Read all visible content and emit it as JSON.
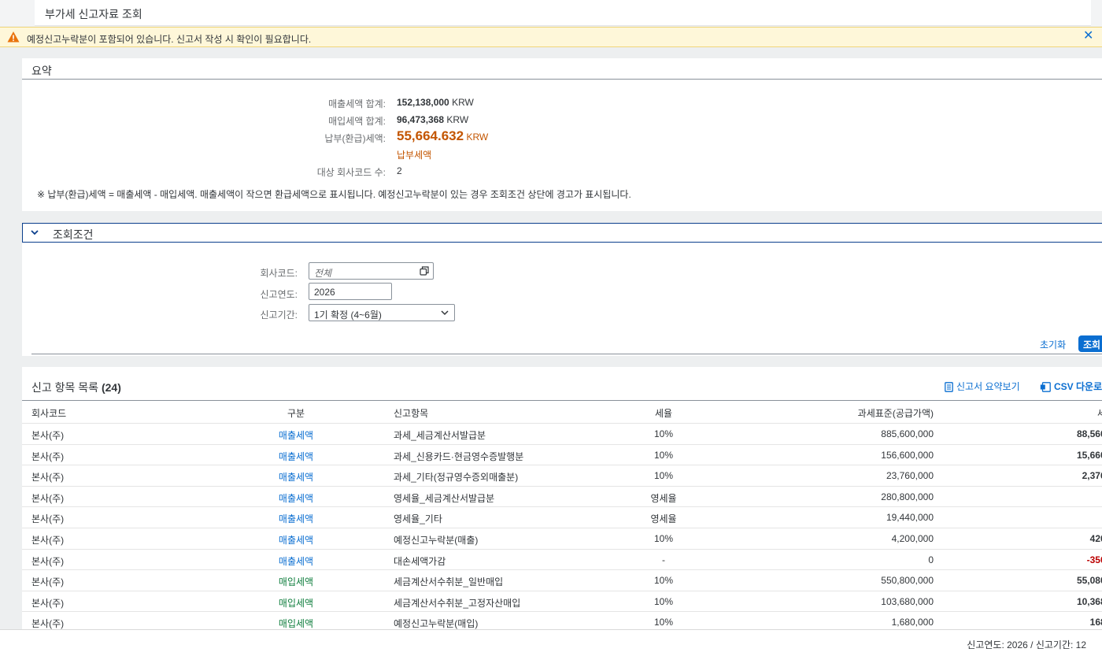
{
  "page": {
    "title": "부가세 신고자료 조회"
  },
  "warning": {
    "text": "예정신고누락분이 포함되어 있습니다. 신고서 작성 시 확인이 필요합니다.",
    "close_icon": "close-icon",
    "colors": {
      "background": "#fef7d9",
      "icon": "#e9730c"
    }
  },
  "summary": {
    "title": "요약",
    "rows": [
      {
        "label": "매출세액 합계:",
        "value": "152,138,000",
        "unit": "KRW"
      },
      {
        "label": "매입세액 합계:",
        "value": "96,473,368",
        "unit": "KRW"
      },
      {
        "label": "납부(환급)세액:",
        "value": "55,664.632",
        "unit": "KRW",
        "sublabel": "납부세액"
      },
      {
        "label": "대상 회사코드 수:",
        "value": "2"
      }
    ],
    "note": "※ 납부(환급)세액 = 매출세액 - 매입세액. 매출세액이 작으면 환급세액으로 표시됩니다. 예정신고누락분이 있는 경우 조회조건 상단에 경고가 표시됩니다.",
    "colors": {
      "payable": "#c35500"
    }
  },
  "conditions": {
    "title": "조회조건",
    "fields": {
      "company": {
        "label": "회사코드:",
        "placeholder": "전체"
      },
      "year": {
        "label": "신고연도:",
        "value": "2026"
      },
      "period": {
        "label": "신고기간:",
        "value": "1기 확정 (4~6월)"
      }
    },
    "reset_label": "초기화",
    "search_label": "조회"
  },
  "table": {
    "title": "신고 항목 목록",
    "count": "(24)",
    "summary_button": "신고서 요약보기",
    "csv_button": "CSV 다운로",
    "columns": [
      "회사코드",
      "구분",
      "신고항목",
      "세율",
      "과세표준(공급가액)",
      "세"
    ],
    "rows": [
      {
        "company": "본사(주)",
        "type": "매출세액",
        "kind": "sales",
        "item": "과세_세금계산서발급분",
        "rate": "10%",
        "base": "885,600,000",
        "tax": "88,560,"
      },
      {
        "company": "본사(주)",
        "type": "매출세액",
        "kind": "sales",
        "item": "과세_신용카드·현금영수증발행분",
        "rate": "10%",
        "base": "156,600,000",
        "tax": "15,660,"
      },
      {
        "company": "본사(주)",
        "type": "매출세액",
        "kind": "sales",
        "item": "과세_기타(정규영수증외매출분)",
        "rate": "10%",
        "base": "23,760,000",
        "tax": "2,376,"
      },
      {
        "company": "본사(주)",
        "type": "매출세액",
        "kind": "sales",
        "item": "영세율_세금계산서발급분",
        "rate": "영세율",
        "base": "280,800,000",
        "tax": ""
      },
      {
        "company": "본사(주)",
        "type": "매출세액",
        "kind": "sales",
        "item": "영세율_기타",
        "rate": "영세율",
        "base": "19,440,000",
        "tax": ""
      },
      {
        "company": "본사(주)",
        "type": "매출세액",
        "kind": "sales",
        "item": "예정신고누락분(매출)",
        "rate": "10%",
        "base": "4,200,000",
        "tax": "420,"
      },
      {
        "company": "본사(주)",
        "type": "매출세액",
        "kind": "sales",
        "item": "대손세액가감",
        "rate": "-",
        "base": "0",
        "tax": "-350,",
        "negative": true
      },
      {
        "company": "본사(주)",
        "type": "매입세액",
        "kind": "purch",
        "item": "세금계산서수취분_일반매입",
        "rate": "10%",
        "base": "550,800,000",
        "tax": "55,080,"
      },
      {
        "company": "본사(주)",
        "type": "매입세액",
        "kind": "purch",
        "item": "세금계산서수취분_고정자산매입",
        "rate": "10%",
        "base": "103,680,000",
        "tax": "10,368,"
      },
      {
        "company": "본사(주)",
        "type": "매입세액",
        "kind": "purch",
        "item": "예정신고누락분(매입)",
        "rate": "10%",
        "base": "1,680,000",
        "tax": "168,"
      }
    ],
    "colors": {
      "sales": "#0a6ed1",
      "purch": "#107e3e",
      "negative": "#bb0000"
    }
  },
  "footer": {
    "text": "신고연도: 2026 / 신고기간: 12"
  }
}
